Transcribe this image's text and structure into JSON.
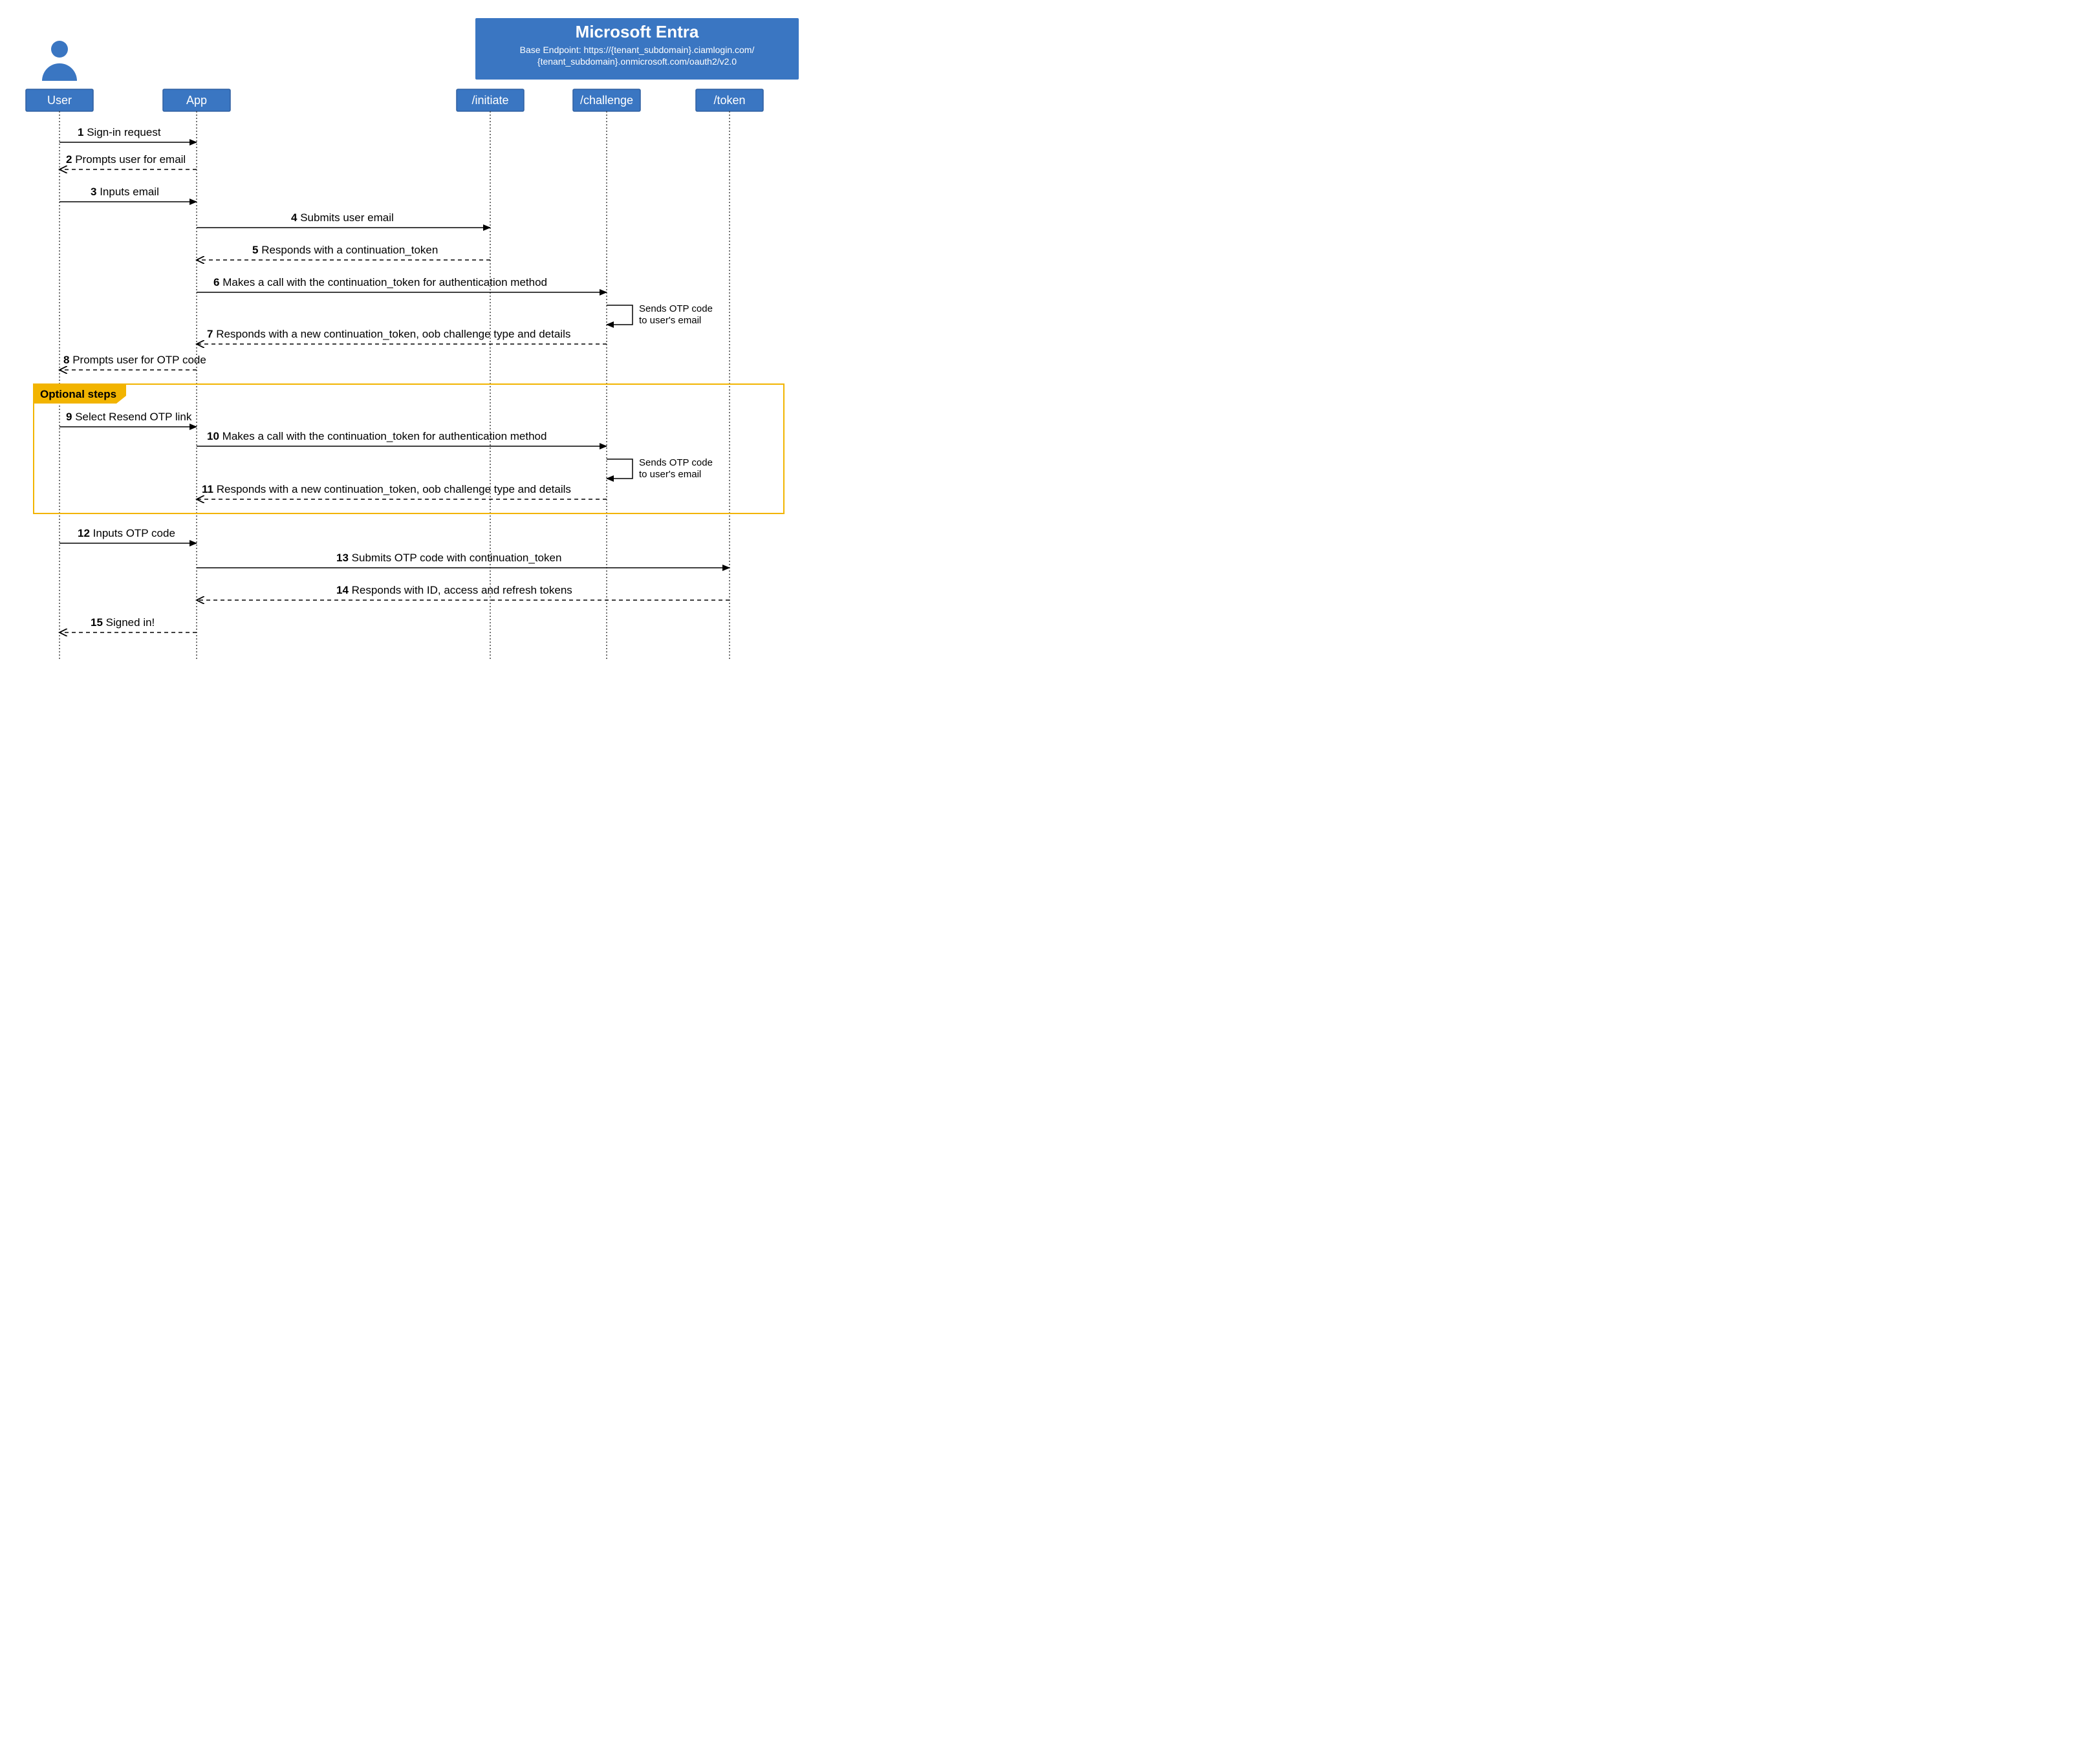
{
  "banner": {
    "title": "Microsoft Entra",
    "sub1": "Base Endpoint: https://{tenant_subdomain}.ciamlogin.com/",
    "sub2": "{tenant_subdomain}.onmicrosoft.com/oauth2/v2.0"
  },
  "participants": {
    "user": "User",
    "app": "App",
    "initiate": "/initiate",
    "challenge": "/challenge",
    "token": "/token"
  },
  "optional_label": "Optional steps",
  "messages": {
    "m1": "Sign-in request",
    "m2": "Prompts user for email",
    "m3": "Inputs email",
    "m4": "Submits user email",
    "m5": "Responds with a continuation_token",
    "m6": "Makes a call with the continuation_token for authentication method",
    "m7": "Responds with a new continuation_token, oob challenge type and details",
    "m8": "Prompts user for OTP code",
    "m9": "Select Resend OTP link",
    "m10": "Makes a call with the continuation_token for authentication method",
    "m11": "Responds with a new continuation_token, oob challenge type and details",
    "m12": "Inputs OTP code",
    "m13": "Submits OTP code with continuation_token",
    "m14": "Responds with  ID, access and refresh tokens",
    "m15": "Signed in!",
    "self1a": "Sends OTP code",
    "self1b": "to user's email",
    "self2a": "Sends OTP code",
    "self2b": "to user's email"
  }
}
